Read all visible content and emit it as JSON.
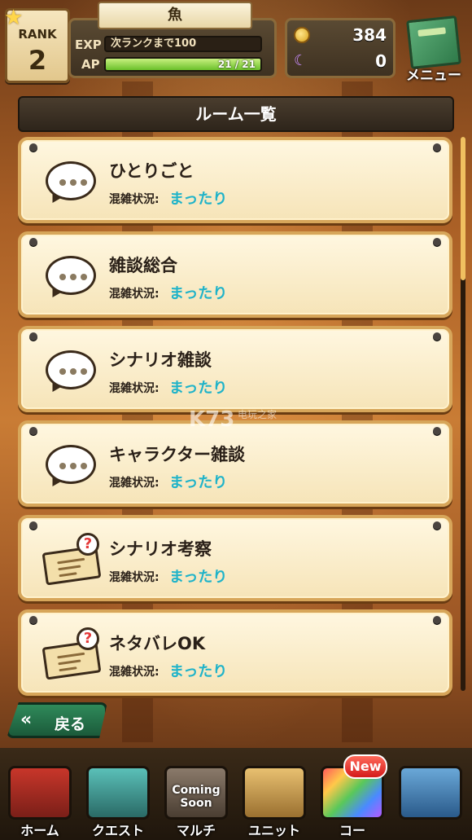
{
  "header": {
    "rank_label": "RANK",
    "rank_value": "2",
    "player_name": "魚",
    "exp_label": "EXP",
    "exp_text": "次ランクまで100",
    "ap_label": "AP",
    "ap_text": "21 / 21",
    "ap_fraction": 1.0,
    "coins": "384",
    "gems": "0",
    "menu_label": "メニュー"
  },
  "title": "ルーム一覧",
  "rooms": [
    {
      "name": "ひとりごと",
      "status_label": "混雑状況:",
      "status_value": "まったり",
      "icon": "speech-bubble-icon"
    },
    {
      "name": "雑談総合",
      "status_label": "混雑状況:",
      "status_value": "まったり",
      "icon": "speech-bubble-icon"
    },
    {
      "name": "シナリオ雑談",
      "status_label": "混雑状況:",
      "status_value": "まったり",
      "icon": "speech-bubble-icon"
    },
    {
      "name": "キャラクター雑談",
      "status_label": "混雑状況:",
      "status_value": "まったり",
      "icon": "speech-bubble-icon"
    },
    {
      "name": "シナリオ考察",
      "status_label": "混雑状況:",
      "status_value": "まったり",
      "icon": "scroll-question-icon"
    },
    {
      "name": "ネタバレOK",
      "status_label": "混雑状況:",
      "status_value": "まったり",
      "icon": "scroll-question-icon"
    }
  ],
  "back_label": "戻る",
  "watermark": {
    "text": "K73",
    "sub": "电玩之家"
  },
  "nav": {
    "home": "ホーム",
    "quest": "クエスト",
    "multi": "マルチ",
    "multi_badge": "Coming Soon",
    "unit": "ユニット",
    "co": "コー",
    "new_badge": "New"
  },
  "colors": {
    "accent_status": "#1fb3c9",
    "card_border": "#d7a65a",
    "back_button": "#2f8a5a"
  }
}
